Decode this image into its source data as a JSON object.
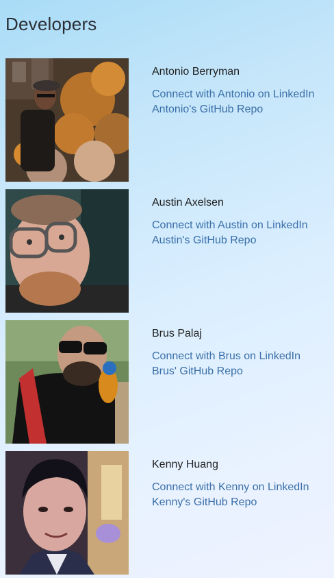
{
  "page": {
    "title": "Developers"
  },
  "developers": [
    {
      "name": "Antonio Berryman",
      "linkedin_label": "Connect with Antonio on LinkedIn",
      "github_label": "Antonio's GitHub Repo"
    },
    {
      "name": "Austin Axelsen",
      "linkedin_label": "Connect with Austin on LinkedIn",
      "github_label": "Austin's GitHub Repo"
    },
    {
      "name": "Brus Palaj",
      "linkedin_label": "Connect with Brus on LinkedIn",
      "github_label": "Brus' GitHub Repo"
    },
    {
      "name": "Kenny Huang",
      "linkedin_label": "Connect with Kenny on LinkedIn",
      "github_label": "Kenny's GitHub Repo"
    }
  ],
  "colors": {
    "link": "#3a6fa8",
    "text": "#222222",
    "background_top": "#a9dcf7",
    "background_bottom": "#eef3ff"
  }
}
